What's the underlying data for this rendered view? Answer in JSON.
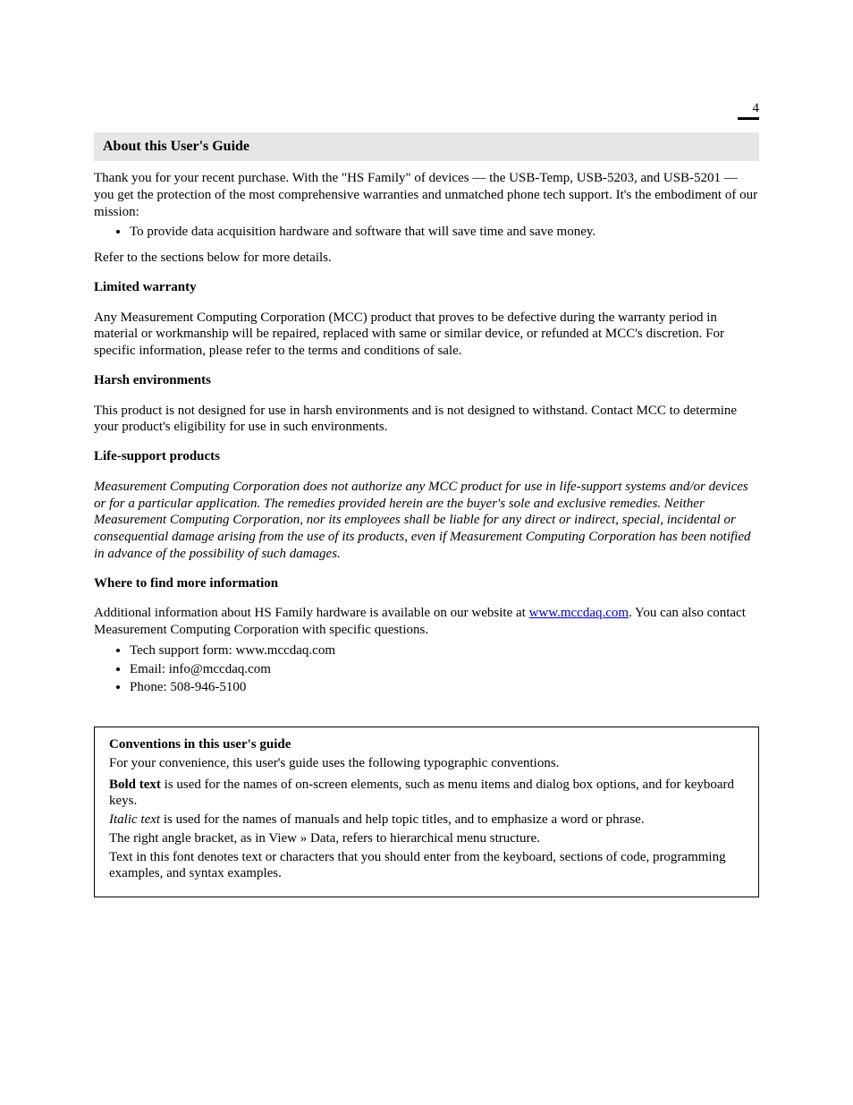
{
  "page": {
    "number": "4"
  },
  "section": {
    "title": "About this User's Guide"
  },
  "intro": {
    "p1": "Thank you for your recent purchase. With the \"HS Family\" of devices — the USB-Temp, USB-5203, and USB-5201 — you get the protection of the most comprehensive warranties and unmatched phone tech support. It's the embodiment of our mission:",
    "bullet1": "To provide data acquisition hardware and software that will save time and save money.",
    "p2": "Refer to the sections below for more details."
  },
  "warranty": {
    "heading": "Limited warranty",
    "p1": "Any Measurement Computing Corporation (MCC) product that proves to be defective during the warranty period in material or workmanship will be repaired, replaced with same or similar device, or refunded at MCC's discretion. For specific information, please refer to the terms and conditions of sale."
  },
  "harsh": {
    "heading": "Harsh environments",
    "p1": "This product is not designed for use in harsh environments and is not designed to withstand. Contact MCC to determine your product's eligibility for use in such environments."
  },
  "lifesupport": {
    "heading": "Life-support products",
    "disclaimer": "Measurement Computing Corporation does not authorize any MCC product for use in life-support systems and/or devices or for a particular application. The remedies provided herein are the buyer's sole and exclusive remedies. Neither Measurement Computing Corporation, nor its employees shall be liable for any direct or indirect, special, incidental or consequential damage arising from the use of its products, even if Measurement Computing Corporation has been notified in advance of the possibility of such damages."
  },
  "whereto": {
    "heading": "Where to find more information",
    "p1": "Additional information about HS Family hardware is available on our website at",
    "link_text": "www.mccdaq.com",
    "p1b": ". You can also contact Measurement Computing Corporation with specific questions.",
    "bullets": [
      "Tech support form: www.mccdaq.com",
      "Email: info@mccdaq.com",
      "Phone: 508-946-5100"
    ]
  },
  "infobox": {
    "title": "Conventions in this user's guide",
    "p1": "For your convenience, this user's guide uses the following typographic conventions.",
    "p2_label": "Bold text",
    "p2_body": " is used for the names of on-screen elements, such as menu items and dialog box options, and for keyboard keys.",
    "p3_label": "Italic text",
    "p3_body": " is used for the names of manuals and help topic titles, and to emphasize a word or phrase.",
    "p4": "The right angle bracket, as in View » Data, refers to hierarchical menu structure.",
    "p5": "Text in this font denotes text or characters that you should enter from the keyboard, sections of code, programming examples, and syntax examples."
  }
}
